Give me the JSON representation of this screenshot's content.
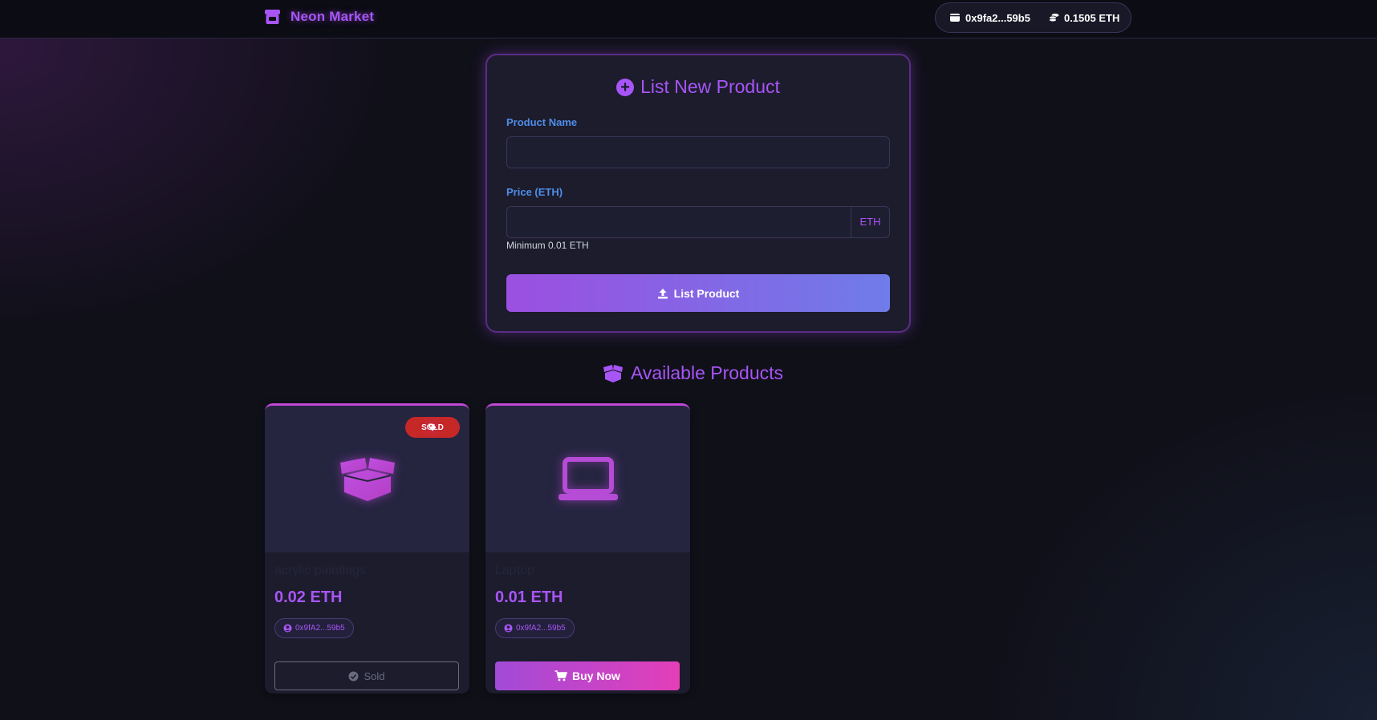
{
  "navbar": {
    "brand": "Neon Market",
    "brand_icon": "store-icon",
    "wallet_address": "0x9fa2...59b5",
    "wallet_icon": "wallet-icon",
    "balance": "0.1505 ETH",
    "balance_icon": "coins-icon"
  },
  "form": {
    "title": "List New Product",
    "title_icon": "plus-circle-icon",
    "name_label": "Product Name",
    "name_value": "",
    "price_label": "Price (ETH)",
    "price_value": "",
    "price_addon": "ETH",
    "price_hint": "Minimum 0.01 ETH",
    "submit_label": "List Product",
    "submit_icon": "upload-icon"
  },
  "products_section": {
    "title": "Available Products",
    "title_icon": "box-open-icon"
  },
  "products": [
    {
      "name": "acrylic paintings",
      "price": "0.02 ETH",
      "owner": "0x9fA2...59b5",
      "status_badge": "SOLD",
      "action_label": "Sold",
      "image_icon": "box-open-icon"
    },
    {
      "name": "Laptop",
      "price": "0.01 ETH",
      "owner": "0x9fA2...59b5",
      "status_badge": "",
      "action_label": "Buy Now",
      "image_icon": "laptop-icon"
    }
  ],
  "colors": {
    "accent": "#a855f7",
    "label_blue": "#4f8de8",
    "sold_red": "#c62828",
    "buy_gradient_start": "#a24ad8",
    "buy_gradient_end": "#e33fb8"
  }
}
